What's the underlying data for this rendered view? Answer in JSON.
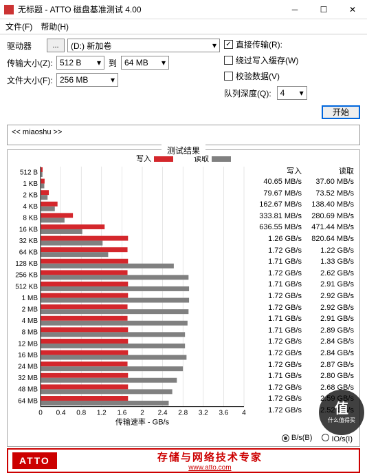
{
  "window": {
    "title": "无标题 - ATTO 磁盘基准测试 4.00"
  },
  "menu": {
    "file": "文件(F)",
    "help": "帮助(H)"
  },
  "ctrl": {
    "drive_lbl": "驱动器",
    "drive_val": "(D:) 新加卷",
    "xfer_lbl": "传输大小(Z):",
    "xfer_from": "512 B",
    "to_lbl": "到",
    "xfer_to": "64 MB",
    "file_lbl": "文件大小(F):",
    "file_val": "256 MB",
    "browse": "...",
    "direct": "直接传输(R):",
    "bypass": "绕过写入缓存(W)",
    "verify": "校验数据(V)",
    "queue_lbl": "队列深度(Q):",
    "queue_val": "4",
    "start": "开始"
  },
  "desc": "<< miaoshu >>",
  "res": {
    "caption": "测试结果",
    "write": "写入",
    "read": "读取",
    "xlabel": "传输速率 - GB/s",
    "unit_bs": "B/s(B)",
    "unit_ios": "IO/s(I)"
  },
  "chart_data": {
    "type": "bar",
    "xlabel": "传输速率 - GB/s",
    "xlim": [
      0,
      4
    ],
    "xticks": [
      0,
      0.4,
      0.8,
      1.2,
      1.6,
      2,
      2.4,
      2.8,
      3.2,
      3.6,
      4
    ],
    "series": [
      {
        "name": "写入",
        "color": "#d4272c"
      },
      {
        "name": "读取",
        "color": "#808080"
      }
    ],
    "categories": [
      "512 B",
      "1 KB",
      "2 KB",
      "4 KB",
      "8 KB",
      "16 KB",
      "32 KB",
      "64 KB",
      "128 KB",
      "256 KB",
      "512 KB",
      "1 MB",
      "2 MB",
      "4 MB",
      "8 MB",
      "12 MB",
      "16 MB",
      "24 MB",
      "32 MB",
      "48 MB",
      "64 MB"
    ],
    "write_gb": [
      0.04065,
      0.07967,
      0.16267,
      0.33381,
      0.63655,
      1.26,
      1.72,
      1.71,
      1.72,
      1.71,
      1.72,
      1.72,
      1.71,
      1.71,
      1.72,
      1.72,
      1.72,
      1.71,
      1.72,
      1.72,
      1.72
    ],
    "read_gb": [
      0.0376,
      0.07352,
      0.1384,
      0.28069,
      0.47144,
      0.82064,
      1.22,
      1.33,
      2.62,
      2.91,
      2.92,
      2.92,
      2.91,
      2.89,
      2.84,
      2.84,
      2.87,
      2.8,
      2.68,
      2.59,
      2.52
    ],
    "write_txt": [
      "40.65 MB/s",
      "79.67 MB/s",
      "162.67 MB/s",
      "333.81 MB/s",
      "636.55 MB/s",
      "1.26 GB/s",
      "1.72 GB/s",
      "1.71 GB/s",
      "1.72 GB/s",
      "1.71 GB/s",
      "1.72 GB/s",
      "1.72 GB/s",
      "1.71 GB/s",
      "1.71 GB/s",
      "1.72 GB/s",
      "1.72 GB/s",
      "1.72 GB/s",
      "1.71 GB/s",
      "1.72 GB/s",
      "1.72 GB/s",
      "1.72 GB/s"
    ],
    "read_txt": [
      "37.60 MB/s",
      "73.52 MB/s",
      "138.40 MB/s",
      "280.69 MB/s",
      "471.44 MB/s",
      "820.64 MB/s",
      "1.22 GB/s",
      "1.33 GB/s",
      "2.62 GB/s",
      "2.91 GB/s",
      "2.92 GB/s",
      "2.92 GB/s",
      "2.91 GB/s",
      "2.89 GB/s",
      "2.84 GB/s",
      "2.84 GB/s",
      "2.87 GB/s",
      "2.80 GB/s",
      "2.68 GB/s",
      "2.59 GB/s",
      "2.52 GB/s"
    ]
  },
  "footer": {
    "logo": "ATTO",
    "tagline": "存储与网络技术专家",
    "url": "www.atto.com"
  },
  "watermark": {
    "big": "值",
    "small": "什么值得买"
  }
}
